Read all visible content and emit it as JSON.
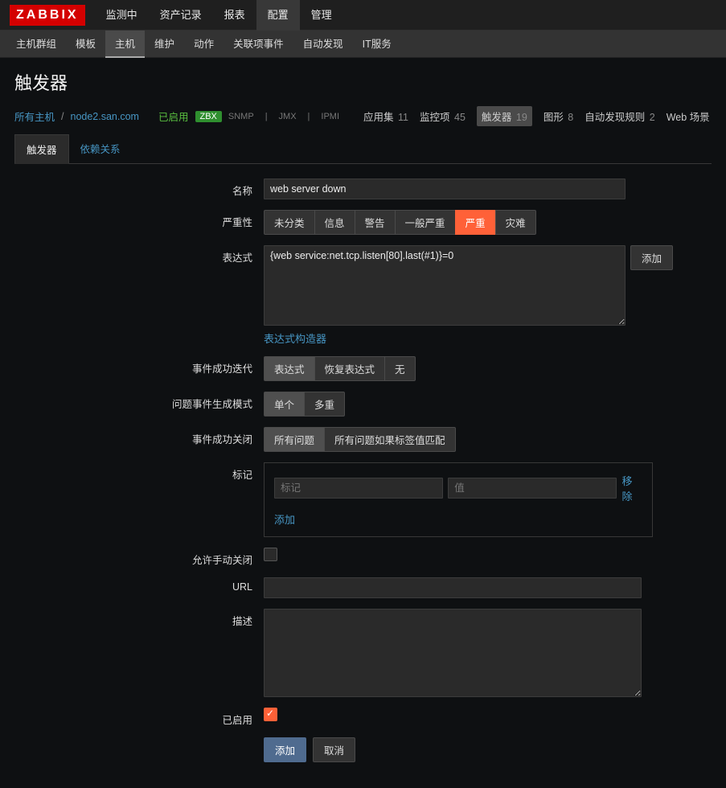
{
  "logo": "ZABBIX",
  "topnav": {
    "items": [
      {
        "label": "监测中"
      },
      {
        "label": "资产记录"
      },
      {
        "label": "报表"
      },
      {
        "label": "配置",
        "active": true
      },
      {
        "label": "管理"
      }
    ]
  },
  "subnav": {
    "items": [
      {
        "label": "主机群组"
      },
      {
        "label": "模板"
      },
      {
        "label": "主机",
        "active": true
      },
      {
        "label": "维护"
      },
      {
        "label": "动作"
      },
      {
        "label": "关联项事件"
      },
      {
        "label": "自动发现"
      },
      {
        "label": "IT服务"
      }
    ]
  },
  "page_title": "触发器",
  "breadcrumb": {
    "all_hosts": "所有主机",
    "host": "node2.san.com"
  },
  "host": {
    "enabled_label": "已启用",
    "interfaces": [
      {
        "label": "ZBX",
        "on": true
      },
      {
        "label": "SNMP"
      },
      {
        "label": "JMX"
      },
      {
        "label": "IPMI"
      }
    ],
    "links": [
      {
        "label": "应用集",
        "count": "11"
      },
      {
        "label": "监控项",
        "count": "45"
      },
      {
        "label": "触发器",
        "count": "19",
        "sel": true
      },
      {
        "label": "图形",
        "count": "8"
      },
      {
        "label": "自动发现规则",
        "count": "2"
      },
      {
        "label": "Web 场景"
      }
    ]
  },
  "tabs": [
    {
      "label": "触发器",
      "active": true
    },
    {
      "label": "依赖关系"
    }
  ],
  "form": {
    "labels": {
      "name": "名称",
      "severity": "严重性",
      "expression": "表达式",
      "expr_builder": "表达式构造器",
      "ok_gen": "事件成功迭代",
      "problem_mode": "问题事件生成模式",
      "ok_close": "事件成功关闭",
      "tags": "标记",
      "manual_close": "允许手动关闭",
      "url": "URL",
      "description": "描述",
      "enabled": "已启用"
    },
    "name": "web server down",
    "severity": {
      "options": [
        "未分类",
        "信息",
        "警告",
        "一般严重",
        "严重",
        "灾难"
      ],
      "selected": 4
    },
    "expression": "{web service:net.tcp.listen[80].last(#1)}=0",
    "expr_add_btn": "添加",
    "ok_gen": {
      "options": [
        "表达式",
        "恢复表达式",
        "无"
      ],
      "selected": 0
    },
    "problem_mode": {
      "options": [
        "单个",
        "多重"
      ],
      "selected": 0
    },
    "ok_close": {
      "options": [
        "所有问题",
        "所有问题如果标签值匹配"
      ],
      "selected": 0
    },
    "tags": {
      "tag_ph": "标记",
      "value_ph": "值",
      "remove": "移除",
      "add": "添加"
    },
    "url": "",
    "description": "",
    "enabled": true,
    "submit": "添加",
    "cancel": "取消"
  }
}
